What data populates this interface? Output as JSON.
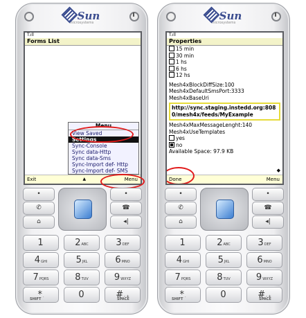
{
  "brand": {
    "name": "Sun",
    "tagline": "microsystems"
  },
  "left_screen": {
    "status": "T.ıll",
    "title": "Forms List",
    "menu": {
      "title": "Menu",
      "items": [
        {
          "label": "View Saved"
        },
        {
          "label": "Settings"
        },
        {
          "label": "Sync-Console"
        },
        {
          "label": "Sync data-Http"
        },
        {
          "label": "Sync data-Sms"
        },
        {
          "label": "Sync-Import def- Http"
        },
        {
          "label": "Sync-Import def- SMS"
        }
      ],
      "selected": "Settings"
    },
    "soft_left": "Exit",
    "soft_mid": "▲",
    "soft_right": "Menu"
  },
  "right_screen": {
    "status": "T.ıll",
    "title": "Properties",
    "rows": {
      "r15": "15 min",
      "r30": "30 min",
      "r1h": "1 hs",
      "r6h": "6 hs",
      "r12h": "12 hs",
      "block": "Mesh4xBlockDiffSize:100",
      "port": "Mesh4xDefaultSmsPort:3333",
      "baseurl_label": "Mesh4xBaseUri",
      "baseurl_value": "http://sync.staging.instedd.org:8080/mesh4x/feeds/MyExample",
      "msglen": "Mesh4xMaxMessageLenght:140",
      "usetemplates": "Mesh4xUseTemplates",
      "yes": "yes",
      "no": "no",
      "space": "Available Space: 97.9 KB"
    },
    "soft_left": "Done",
    "soft_right": "Menu",
    "scroll_glyph": "◆"
  },
  "keypad": {
    "keys": [
      {
        "d": "1",
        "s": ""
      },
      {
        "d": "2",
        "s": "ABC"
      },
      {
        "d": "3",
        "s": "DEF"
      },
      {
        "d": "4",
        "s": "GHI"
      },
      {
        "d": "5",
        "s": "JKL"
      },
      {
        "d": "6",
        "s": "MNO"
      },
      {
        "d": "7",
        "s": "PQRS"
      },
      {
        "d": "8",
        "s": "TUV"
      },
      {
        "d": "9",
        "s": "WXYZ"
      },
      {
        "d": "*",
        "s": "."
      },
      {
        "d": "0",
        "s": ""
      },
      {
        "d": "#",
        "s": "- +"
      }
    ],
    "shift": "SHIFT",
    "space": "SPACE",
    "dot": "•",
    "call": "✆",
    "end": "☎",
    "home": "⌂",
    "back": "◂|"
  },
  "colors": {
    "highlight": "#e11a1a",
    "url_border": "#e6db3a",
    "softbar": "#ffffd6",
    "title_bg": "#f3f3c9"
  }
}
